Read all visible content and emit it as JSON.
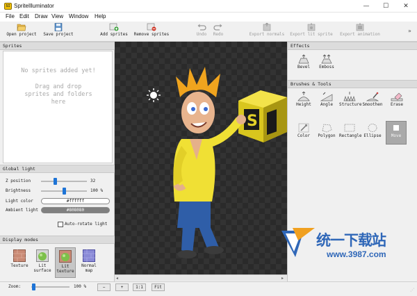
{
  "window": {
    "title": "SpriteIlluminator",
    "icon_text": "SI",
    "controls": {
      "minimize": "—",
      "maximize": "☐",
      "close": "✕"
    }
  },
  "menu": [
    "File",
    "Edit",
    "Draw",
    "View",
    "Window",
    "Help"
  ],
  "toolbar": {
    "open_project": "Open project",
    "save_project": "Save project",
    "add_sprites": "Add sprites",
    "remove_sprites": "Remove sprites",
    "undo": "Undo",
    "redo": "Redo",
    "export_normals": "Export normals",
    "export_lit_sprite": "Export lit sprite",
    "export_animation": "Export animation",
    "overflow": "»"
  },
  "sprites_panel": {
    "title": "Sprites",
    "empty_title": "No sprites added yet!",
    "hint_line1": "Drag and drop",
    "hint_line2": "sprites and folders",
    "hint_line3": "here"
  },
  "global_light": {
    "title": "Global light",
    "z_position_label": "Z position",
    "z_position_value": "32",
    "z_position_level": 0.3,
    "brightness_label": "Brightness",
    "brightness_value": "100 %",
    "brightness_level": 0.5,
    "light_color_label": "Light color",
    "light_color_value": "#ffffff",
    "ambient_light_label": "Ambient light",
    "ambient_light_value": "#808080",
    "auto_rotate_label": "Auto-rotate light"
  },
  "display_modes": {
    "title": "Display modes",
    "items": [
      "Texture",
      "Lit surface",
      "Lit texture",
      "Normal map"
    ],
    "items_line1": [
      "Texture",
      "Lit",
      "Lit",
      "Normal"
    ],
    "items_line2": [
      "",
      "surface",
      "texture",
      "map"
    ],
    "selected": "Lit texture"
  },
  "effects": {
    "title": "Effects",
    "items": [
      "Bevel",
      "Emboss"
    ]
  },
  "brushes_tools": {
    "title": "Brushes & Tools",
    "row1": [
      "Height",
      "Angle",
      "Structure",
      "Smoothen",
      "Erase"
    ],
    "row2": [
      "Color",
      "Polygon",
      "Rectangle",
      "Ellipse",
      "Move"
    ]
  },
  "status": {
    "zoom_label": "Zoom:",
    "zoom_value": "100 %",
    "zoom_level": 0.05,
    "minus": "−",
    "plus": "+",
    "one_to_one": "1:1",
    "fit": "Fit"
  },
  "watermark": {
    "main": "统一下载站",
    "url": "www.3987.com"
  },
  "colors": {
    "accent": "#1e74d6",
    "ambient": "#808080",
    "watermark": "#2f67b8"
  }
}
